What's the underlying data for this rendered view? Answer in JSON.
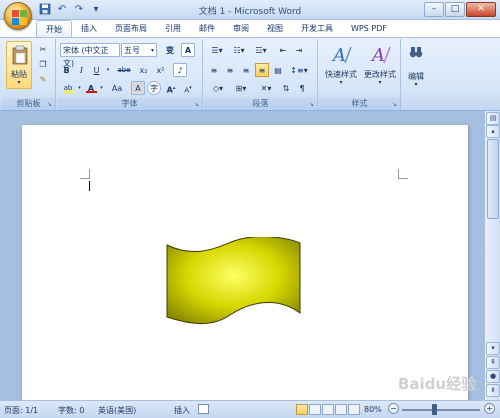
{
  "window": {
    "title": "文档 1 - Microsoft Word"
  },
  "qat": {
    "save_icon": "save-icon",
    "undo": "↶",
    "redo": "↷",
    "more": "▾"
  },
  "tabs": [
    "开始",
    "插入",
    "页面布局",
    "引用",
    "邮件",
    "审阅",
    "视图",
    "开发工具",
    "WPS PDF"
  ],
  "clipboard": {
    "paste_label": "粘贴",
    "group_label": "剪贴板"
  },
  "font": {
    "name": "宋体 (中文正文)",
    "size": "五号",
    "grow": "A",
    "shrink": "A",
    "wen": "变",
    "clear": "A",
    "bold": "B",
    "italic": "I",
    "underline": "U",
    "strike": "abe",
    "subscript": "x₂",
    "superscript": "x²",
    "highlight": "ab",
    "font_color": "A",
    "case": "Aa",
    "char_shading": "A",
    "enclose": "字",
    "group_label": "字体",
    "color_red": "#e00000",
    "color_yellow": "#ffff00"
  },
  "paragraph": {
    "group_label": "段落"
  },
  "styles": {
    "quick_label": "快速样式",
    "change_label": "更改样式",
    "group_label": "样式"
  },
  "editing": {
    "label": "编辑"
  },
  "status": {
    "page": "页面: 1/1",
    "words": "字数: 0",
    "language": "英语(美国)",
    "mode": "插入",
    "zoom": "80%"
  },
  "shape": {
    "type": "wave",
    "fill_light": "#ffff66",
    "fill_dark": "#8a8a00",
    "stroke": "#3b3b00"
  },
  "watermark": "Baidu经验"
}
